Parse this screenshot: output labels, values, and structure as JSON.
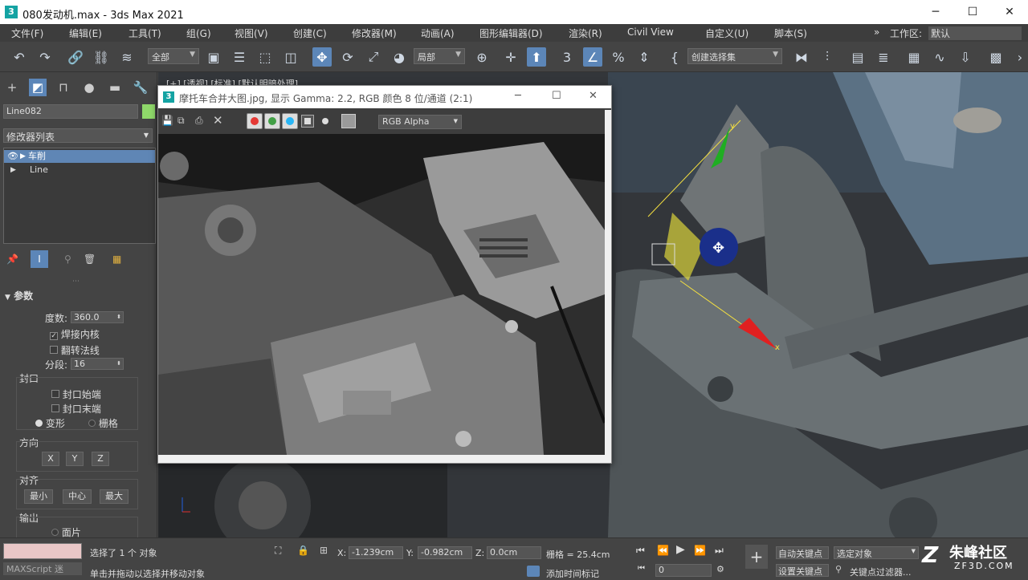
{
  "app": {
    "title": "080发动机.max - 3ds Max 2021",
    "logo": "3",
    "win_min": "─",
    "win_max": "☐",
    "win_close": "✕"
  },
  "menu": {
    "items": [
      "文件(F)",
      "编辑(E)",
      "工具(T)",
      "组(G)",
      "视图(V)",
      "创建(C)",
      "修改器(M)",
      "动画(A)",
      "图形编辑器(D)",
      "渲染(R)",
      "Civil View",
      "自定义(U)",
      "脚本(S)"
    ],
    "workspace_label": "工作区:",
    "workspace_value": "默认"
  },
  "toolbar": {
    "selection_filter": "全部",
    "ref_coord": "局部",
    "named_sel": "创建选择集"
  },
  "command_panel": {
    "object_name": "Line082",
    "modifier_list": "修改器列表",
    "stack": [
      {
        "label": "车削",
        "selected": true
      },
      {
        "label": "Line",
        "selected": false
      }
    ],
    "params": {
      "title": "参数",
      "degrees_label": "度数:",
      "degrees_value": "360.0",
      "weld_core": "焊接内核",
      "flip_normals": "翻转法线",
      "segments_label": "分段:",
      "segments_value": "16",
      "capping_label": "封口",
      "cap_start": "封口始端",
      "cap_end": "封口末端",
      "morph": "变形",
      "grid": "栅格",
      "direction_label": "方向",
      "dir_x": "X",
      "dir_y": "Y",
      "dir_z": "Z",
      "align_label": "对齐",
      "align_min": "最小",
      "align_center": "中心",
      "align_max": "最大",
      "output_label": "输出",
      "output_patch": "面片"
    }
  },
  "viewport": {
    "label": "[+] [透视] [标准] [默认明暗处理]"
  },
  "frame_window": {
    "title": "摩托车合并大图.jpg, 显示 Gamma: 2.2, RGB 颜色 8 位/通道 (2:1)",
    "channel": "RGB Alpha",
    "channel_colors": [
      "#e53935",
      "#43a047",
      "#29b6f6"
    ]
  },
  "status": {
    "maxscript": "MAXScript 迷",
    "selected": "选择了 1 个 对象",
    "prompt": "单击并拖动以选择并移动对象",
    "x_label": "X:",
    "x_value": "-1.239cm",
    "y_label": "Y:",
    "y_value": "-0.982cm",
    "z_label": "Z:",
    "z_value": "0.0cm",
    "grid": "栅格 = 25.4cm",
    "add_time_tag": "添加时间标记",
    "frame": "0",
    "auto_key": "自动关键点",
    "set_key": "设置关键点",
    "sel_set": "选定对象",
    "key_filters": "关键点过滤器..."
  },
  "watermark": {
    "name": "朱峰社区",
    "url": "ZF3D.COM"
  }
}
